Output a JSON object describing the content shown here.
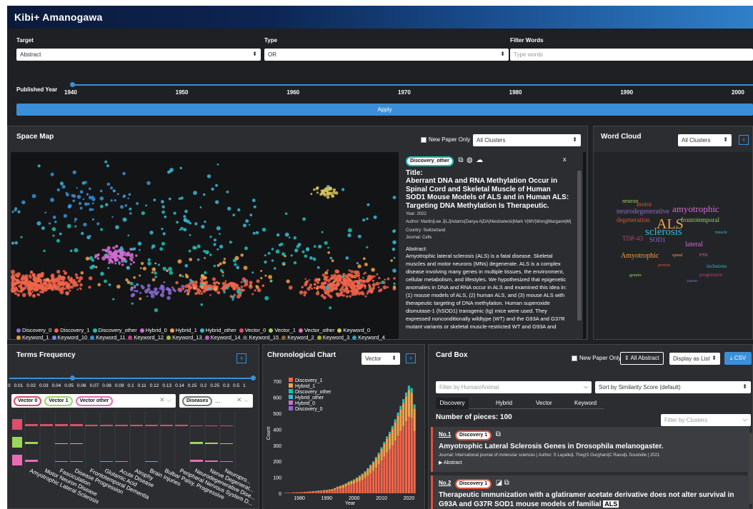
{
  "app": {
    "title": "Kibi+ Amanogawa"
  },
  "filters": {
    "target_label": "Target",
    "target_value": "Abstract",
    "type_label": "Type",
    "type_value": "OR",
    "words_label": "Filter Words",
    "words_placeholder": "Type words",
    "year_label": "Published Year",
    "year_ticks": [
      "1940",
      "1950",
      "1960",
      "1970",
      "1980",
      "1990",
      "2000"
    ],
    "apply_label": "Apply"
  },
  "space_map": {
    "title": "Space Map",
    "new_paper_label": "New Paper Only",
    "cluster_select": "All Clusters",
    "legend_row1": [
      {
        "name": "Discovery_0",
        "color": "#8b6bd6"
      },
      {
        "name": "Discovery_1",
        "color": "#f2644a"
      },
      {
        "name": "Discovery_other",
        "color": "#1ec0b0"
      },
      {
        "name": "Hybrid_0",
        "color": "#d46bd4"
      },
      {
        "name": "Hybrid_1",
        "color": "#f2a24a"
      },
      {
        "name": "Hybrid_other",
        "color": "#39b8d6"
      },
      {
        "name": "Vector_0",
        "color": "#e04c6a"
      },
      {
        "name": "Vector_1",
        "color": "#9bd65a"
      },
      {
        "name": "Vector_other",
        "color": "#e86bb8"
      },
      {
        "name": "Keyword_0",
        "color": "#d6c45a"
      }
    ],
    "legend_row2": [
      {
        "name": "Keyword_1",
        "color": "#e0a030"
      },
      {
        "name": "Keyword_10",
        "color": "#7a8ae0"
      },
      {
        "name": "Keyword_11",
        "color": "#3a8fd8"
      },
      {
        "name": "Keyword_12",
        "color": "#c04080"
      },
      {
        "name": "Keyword_13",
        "color": "#a0c040"
      },
      {
        "name": "Keyword_14",
        "color": "#c060d0"
      },
      {
        "name": "Keyword_15",
        "color": "#666666"
      },
      {
        "name": "Keyword_2",
        "color": "#8a6a30"
      },
      {
        "name": "Keyword_3",
        "color": "#b0b030"
      },
      {
        "name": "Keyword_4",
        "color": "#30a0c0"
      }
    ]
  },
  "paper_detail": {
    "badge": "Discovery_other",
    "close": "x",
    "title_label": "Title:",
    "title": "Aberrant DNA and RNA Methylation Occur in Spinal Cord and Skeletal Muscle of Human SOD1 Mouse Models of ALS and in Human ALS: Targeting DNA Methylation Is Therapeutic.",
    "year": "Year: 2022",
    "author": "Author: Martin|Lee J|LJ|Adams|Danya A|DA|Niedzwiecki|Mark V|MV|Wong|Margaret|M|",
    "country": "Country: Switzerland",
    "journal": "Journal: Cells",
    "abstract_label": "Abstract:",
    "abstract": "Amyotrophic lateral sclerosis (ALS) is a fatal disease. Skeletal muscles and motor neurons (MNs) degenerate. ALS is a complex disease involving many genes in multiple tissues, the environment, cellular metabolism, and lifestyles. We hypothesized that epigenetic anomalies in DNA and RNA occur in ALS and examined this idea in: (1) mouse models of ALS, (2) human ALS, and (3) mouse ALS with therapeutic targeting of DNA methylation. Human superoxide dismutase-1 (hSOD1) transgenic (tg) mice were used. They expressed nonconditionally wildtype (WT) and the G93A and G37R mutant variants or skeletal muscle-restricted WT and G93A and"
  },
  "word_cloud": {
    "title": "Word Cloud",
    "select": "All Clusters",
    "words": [
      "neurodegenerative",
      "amyotrophic",
      "ALS",
      "degeneration",
      "frontotemporal",
      "sclerosis",
      "TDP-43",
      "SOD1",
      "lateral",
      "Amyotrophic",
      "motor",
      "neuron",
      "inclusions",
      "progressive",
      "causes",
      "FTD",
      "spinal",
      "protein",
      "genetic",
      "muscle"
    ]
  },
  "terms": {
    "title": "Terms Frequency",
    "scale": [
      "0",
      "0.01",
      "0.02",
      "0.03",
      "0.04",
      "0.05",
      "0.06",
      "0.07",
      "0.08",
      "0.09",
      "0.1",
      "0.11",
      "0.12",
      "0.13",
      "0.14",
      "0.15",
      "0.2",
      "0.25",
      "0.3",
      "0.5",
      "1"
    ],
    "chips_left": [
      {
        "name": "Vector 0",
        "color": "#e04c6a"
      },
      {
        "name": "Vector 1",
        "color": "#9bd65a"
      },
      {
        "name": "Vector other",
        "color": "#e86bb8"
      }
    ],
    "chip_right": "Diseases",
    "chip_right_more": "...",
    "terms": [
      "Amyotrophic Lateral Sclerosis",
      "Motor Neuron Disease",
      "Fasciculation",
      "Disease Progression",
      "Frontotemporal Dementia",
      "Glutamic Acid",
      "Acute Disease",
      "Atrophy",
      "Brain Injuries",
      "Bulbar Palsy, Progressive",
      "Peripheral Nervous System D...",
      "Neurodegenerative Dise...",
      "Nerve Degenerat...",
      "Neuropro..."
    ]
  },
  "chrono": {
    "title": "Chronological Chart",
    "select": "Vector",
    "ylabel": "Count",
    "xlabel": "Year",
    "legend": [
      {
        "name": "Discovery_1",
        "color": "#f2644a"
      },
      {
        "name": "Hybrid_1",
        "color": "#f2a24a"
      },
      {
        "name": "Discovery_other",
        "color": "#1ec0b0"
      },
      {
        "name": "Hybrid_other",
        "color": "#39b8d6"
      },
      {
        "name": "Hybrid_0",
        "color": "#d46bd4"
      },
      {
        "name": "Discovery_0",
        "color": "#8b6bd6"
      }
    ],
    "yticks": [
      "0",
      "100",
      "200",
      "300",
      "400",
      "500",
      "600",
      "700"
    ],
    "xticks": [
      "1980",
      "1990",
      "2000",
      "2010",
      "2020"
    ]
  },
  "chart_data": {
    "type": "bar",
    "title": "Chronological Chart",
    "xlabel": "Year",
    "ylabel": "Count",
    "ylim": [
      0,
      750
    ],
    "x": [
      1975,
      1976,
      1977,
      1978,
      1979,
      1980,
      1981,
      1982,
      1983,
      1984,
      1985,
      1986,
      1987,
      1988,
      1989,
      1990,
      1991,
      1992,
      1993,
      1994,
      1995,
      1996,
      1997,
      1998,
      1999,
      2000,
      2001,
      2002,
      2003,
      2004,
      2005,
      2006,
      2007,
      2008,
      2009,
      2010,
      2011,
      2012,
      2013,
      2014,
      2015,
      2016,
      2017,
      2018,
      2019,
      2020,
      2021,
      2022
    ],
    "series": [
      {
        "name": "Discovery_1",
        "values": [
          2,
          3,
          3,
          4,
          4,
          5,
          6,
          6,
          7,
          8,
          9,
          10,
          11,
          12,
          13,
          14,
          16,
          18,
          22,
          28,
          32,
          36,
          42,
          50,
          55,
          60,
          68,
          76,
          85,
          95,
          110,
          125,
          140,
          160,
          180,
          205,
          230,
          255,
          275,
          300,
          330,
          360,
          390,
          420,
          450,
          480,
          470,
          390
        ]
      },
      {
        "name": "Hybrid_1",
        "values": [
          1,
          1,
          1,
          2,
          2,
          2,
          2,
          3,
          3,
          3,
          4,
          4,
          5,
          5,
          6,
          6,
          7,
          8,
          10,
          12,
          14,
          16,
          18,
          20,
          22,
          24,
          27,
          30,
          33,
          37,
          42,
          47,
          52,
          58,
          64,
          72,
          80,
          88,
          96,
          105,
          115,
          125,
          135,
          145,
          155,
          165,
          160,
          140
        ]
      },
      {
        "name": "Discovery_other",
        "values": [
          0,
          0,
          0,
          0,
          0,
          0,
          0,
          0,
          0,
          0,
          0,
          1,
          1,
          1,
          1,
          1,
          1,
          1,
          2,
          2,
          2,
          2,
          3,
          3,
          3,
          4,
          4,
          5,
          5,
          6,
          6,
          7,
          8,
          9,
          10,
          11,
          12,
          13,
          14,
          16,
          18,
          20,
          22,
          24,
          26,
          28,
          28,
          26
        ]
      }
    ]
  },
  "cardbox": {
    "title": "Card Box",
    "new_paper_label": "New Paper Only",
    "all_abstract": "All Abstract",
    "display": "Display as List",
    "csv": "CSV",
    "filter_human": "Filter by Human/Animal",
    "sort": "Sort by Similarity Score (default)",
    "tabs": [
      "Discovery",
      "Hybrid",
      "Vector",
      "Keyword"
    ],
    "count": "Number of pieces: 100",
    "filter_clusters": "Filter by Clusters",
    "cards": [
      {
        "no": "No.1",
        "badge": "Discovery 1",
        "title": "Amyotrophic Lateral Sclerosis Genes in Drosophila melanogaster.",
        "meta": "Journal: International journal of molecular sciences | Author: S Layalle|L They|S Ourghani|C Raoul|L Soustelle | 2021",
        "abstract": "▶ Abstract"
      },
      {
        "no": "No.2",
        "badge": "Discovery 1",
        "title": "Therapeutic immunization with a glatiramer acetate derivative does not alter survival in G93A and G37R SOD1 mouse models of familial",
        "tooltip": "ALS"
      }
    ]
  }
}
